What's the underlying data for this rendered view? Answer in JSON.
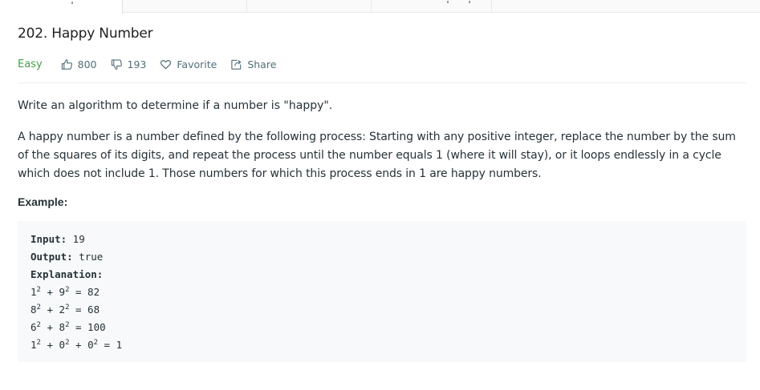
{
  "problem": {
    "title": "202. Happy Number",
    "difficulty": "Easy",
    "likes": "800",
    "dislikes": "193",
    "favorite_label": "Favorite",
    "share_label": "Share"
  },
  "description": {
    "p1": "Write an algorithm to determine if a number is \"happy\".",
    "p2": "A happy number is a number defined by the following process: Starting with any positive integer, replace the number by the sum of the squares of its digits, and repeat the process until the number equals 1 (where it will stay), or it loops endlessly in a cycle which does not include 1. Those numbers for which this process ends in 1 are happy numbers.",
    "example_label": "Example:"
  },
  "example": {
    "input_label": "Input:",
    "input_value": " 19",
    "output_label": "Output:",
    "output_value": " true",
    "explanation_label": "Explanation:",
    "steps": [
      {
        "a": "1",
        "b": "9",
        "c": null,
        "result": "82"
      },
      {
        "a": "8",
        "b": "2",
        "c": null,
        "result": "68"
      },
      {
        "a": "6",
        "b": "8",
        "c": null,
        "result": "100"
      },
      {
        "a": "1",
        "b": "0",
        "c": "0",
        "result": "1"
      }
    ],
    "exponent": "2"
  },
  "colors": {
    "easy": "#43a047",
    "meta_text": "#546e7a",
    "code_bg": "#f7f9fa"
  },
  "icons": {
    "likes": "thumbs-up-icon",
    "dislikes": "thumbs-down-icon",
    "favorite": "heart-icon",
    "share": "share-icon"
  }
}
